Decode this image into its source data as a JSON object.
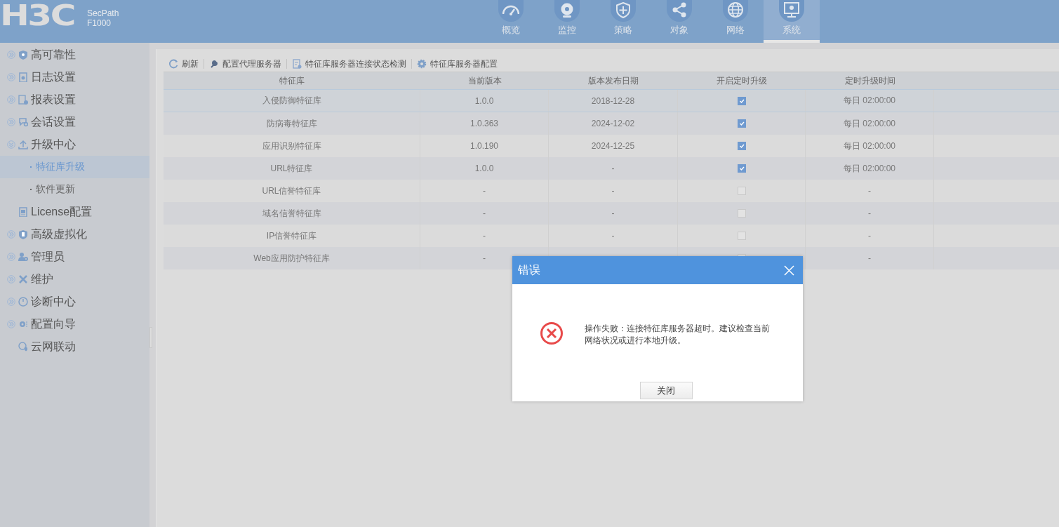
{
  "header": {
    "logo": "H3C",
    "product": "SecPath",
    "model": "F1000"
  },
  "nav": [
    {
      "label": "概览",
      "selected": false
    },
    {
      "label": "监控",
      "selected": false
    },
    {
      "label": "策略",
      "selected": false
    },
    {
      "label": "对象",
      "selected": false
    },
    {
      "label": "网络",
      "selected": false
    },
    {
      "label": "系统",
      "selected": true
    }
  ],
  "sidebar": {
    "items": [
      {
        "label": "高可靠性",
        "expandable": true,
        "expanded": false,
        "selected": false
      },
      {
        "label": "日志设置",
        "expandable": true,
        "expanded": false,
        "selected": false
      },
      {
        "label": "报表设置",
        "expandable": true,
        "expanded": false,
        "selected": false
      },
      {
        "label": "会话设置",
        "expandable": true,
        "expanded": false,
        "selected": false
      },
      {
        "label": "升级中心",
        "expandable": true,
        "expanded": true,
        "selected": false,
        "children": [
          {
            "label": "特征库升级",
            "selected": true
          },
          {
            "label": "软件更新",
            "selected": false
          }
        ]
      },
      {
        "label": "License配置",
        "expandable": false,
        "selected": false
      },
      {
        "label": "高级虚拟化",
        "expandable": true,
        "expanded": false,
        "selected": false
      },
      {
        "label": "管理员",
        "expandable": true,
        "expanded": false,
        "selected": false
      },
      {
        "label": "维护",
        "expandable": true,
        "expanded": false,
        "selected": false
      },
      {
        "label": "诊断中心",
        "expandable": true,
        "expanded": false,
        "selected": false
      },
      {
        "label": "配置向导",
        "expandable": true,
        "expanded": false,
        "selected": false
      },
      {
        "label": "云网联动",
        "expandable": false,
        "selected": false
      }
    ]
  },
  "toolbar": [
    "刷新",
    "配置代理服务器",
    "特征库服务器连接状态检测",
    "特征库服务器配置"
  ],
  "table": {
    "columns": [
      "特征库",
      "当前版本",
      "版本发布日期",
      "开启定时升级",
      "定时升级时间"
    ],
    "rows": [
      {
        "name": "入侵防御特征库",
        "version": "1.0.0",
        "release_date": "2018-12-28",
        "scheduled": true,
        "time": "每日 02:00:00",
        "selected": true
      },
      {
        "name": "防病毒特征库",
        "version": "1.0.363",
        "release_date": "2024-12-02",
        "scheduled": true,
        "time": "每日 02:00:00",
        "selected": false
      },
      {
        "name": "应用识别特征库",
        "version": "1.0.190",
        "release_date": "2024-12-25",
        "scheduled": true,
        "time": "每日 02:00:00",
        "selected": false
      },
      {
        "name": "URL特征库",
        "version": "1.0.0",
        "release_date": "-",
        "scheduled": true,
        "time": "每日 02:00:00",
        "selected": false
      },
      {
        "name": "URL信誉特征库",
        "version": "-",
        "release_date": "-",
        "scheduled": false,
        "time": "-",
        "selected": false
      },
      {
        "name": "域名信誉特征库",
        "version": "-",
        "release_date": "-",
        "scheduled": false,
        "time": "-",
        "selected": false
      },
      {
        "name": "IP信誉特征库",
        "version": "-",
        "release_date": "-",
        "scheduled": false,
        "time": "-",
        "selected": false
      },
      {
        "name": "Web应用防护特征库",
        "version": "-",
        "scheduled": false,
        "time": "-",
        "selected": false
      }
    ]
  },
  "dialog": {
    "title": "错误",
    "message": "操作失败：连接特征库服务器超时。建议检查当前网络状况或进行本地升级。",
    "button": "关闭"
  }
}
